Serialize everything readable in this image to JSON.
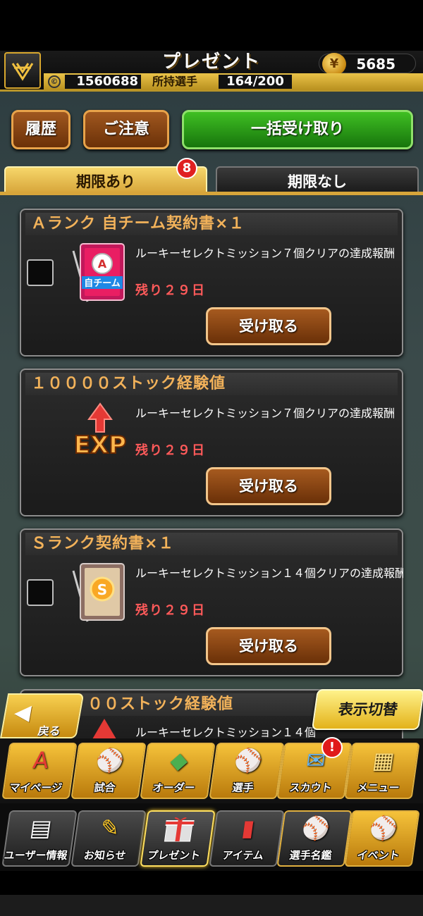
{
  "header": {
    "title": "プレゼント",
    "coins": "5685",
    "money": "1560688",
    "players_label": "所持選手",
    "players_value": "164/200"
  },
  "actions": {
    "history": "履歴",
    "notice": "ご注意",
    "receive_all": "一括受け取り"
  },
  "tabs": {
    "with_limit": "期限あり",
    "no_limit": "期限なし",
    "badge_count": "8"
  },
  "items": [
    {
      "title": "Ａランク 自チーム契約書×１",
      "description": "ルーキーセレクトミッション７個クリアの達成報酬",
      "limit": "残り２９日",
      "button": "受け取る",
      "icon": "team-contract-icon",
      "icon_text": "自チーム"
    },
    {
      "title": "１００００ストック経験値",
      "description": "ルーキーセレクトミッション７個クリアの達成報酬",
      "limit": "残り２９日",
      "button": "受け取る",
      "icon": "exp-icon",
      "icon_text": "EXP"
    },
    {
      "title": "Ｓランク契約書×１",
      "description": "ルーキーセレクトミッション１４個クリアの達成報酬",
      "limit": "残り２９日",
      "button": "受け取る",
      "icon": "s-contract-icon",
      "icon_text": "S"
    }
  ],
  "partial_item": {
    "title": "００ストック経験値",
    "description": "ルーキーセレクトミッション１４個"
  },
  "controls": {
    "back": "戻る",
    "toggle": "表示切替"
  },
  "nav_row1": [
    {
      "label": "マイページ",
      "icon": "A"
    },
    {
      "label": "試合",
      "icon": "⚾"
    },
    {
      "label": "オーダー",
      "icon": "◆"
    },
    {
      "label": "選手",
      "icon": "⚾"
    },
    {
      "label": "スカウト",
      "icon": "✉"
    },
    {
      "label": "メニュー",
      "icon": "▦"
    }
  ],
  "nav_row2": [
    {
      "label": "ユーザー情報",
      "icon": "▤"
    },
    {
      "label": "お知らせ",
      "icon": "✎"
    },
    {
      "label": "プレゼント",
      "icon": "🎁"
    },
    {
      "label": "アイテム",
      "icon": "▮"
    },
    {
      "label": "選手名鑑",
      "icon": "⚾"
    },
    {
      "label": "イベント",
      "icon": "⚾"
    }
  ],
  "scout_alert": "!"
}
